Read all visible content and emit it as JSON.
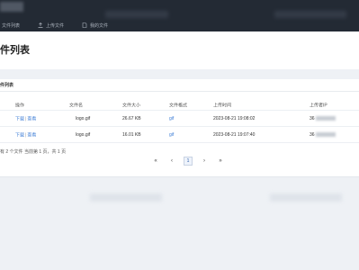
{
  "nav": {
    "items": [
      {
        "label": "文件列表",
        "icon": "list-icon"
      },
      {
        "label": "上传文件",
        "icon": "upload-icon"
      },
      {
        "label": "我的文件",
        "icon": "file-icon"
      }
    ]
  },
  "header": {
    "title": "件列表"
  },
  "panel": {
    "title": "件列表",
    "columns": [
      "操作",
      "文件名",
      "文件大小",
      "文件格式",
      "上传时间",
      "上传者IP"
    ],
    "rows": [
      {
        "download": "下载",
        "sep": "|",
        "view": "查看",
        "name": "logo.gif",
        "size": "26.67 KB",
        "format": "gif",
        "time": "2023-08-21 19:08:02",
        "ip": "36"
      },
      {
        "download": "下载",
        "sep": "|",
        "view": "查看",
        "name": "logo.gif",
        "size": "16.01 KB",
        "format": "gif",
        "time": "2023-08-21 19:07:40",
        "ip": "36"
      }
    ],
    "summary": "有 2 个文件  当前第 1 页，共 1 页"
  },
  "pagination": {
    "first": "«",
    "prev": "‹",
    "current": "1",
    "next": "›",
    "last": "»"
  },
  "colors": {
    "topbar": "#232a34",
    "link": "#3a7bd5",
    "background": "#eef1f5"
  }
}
